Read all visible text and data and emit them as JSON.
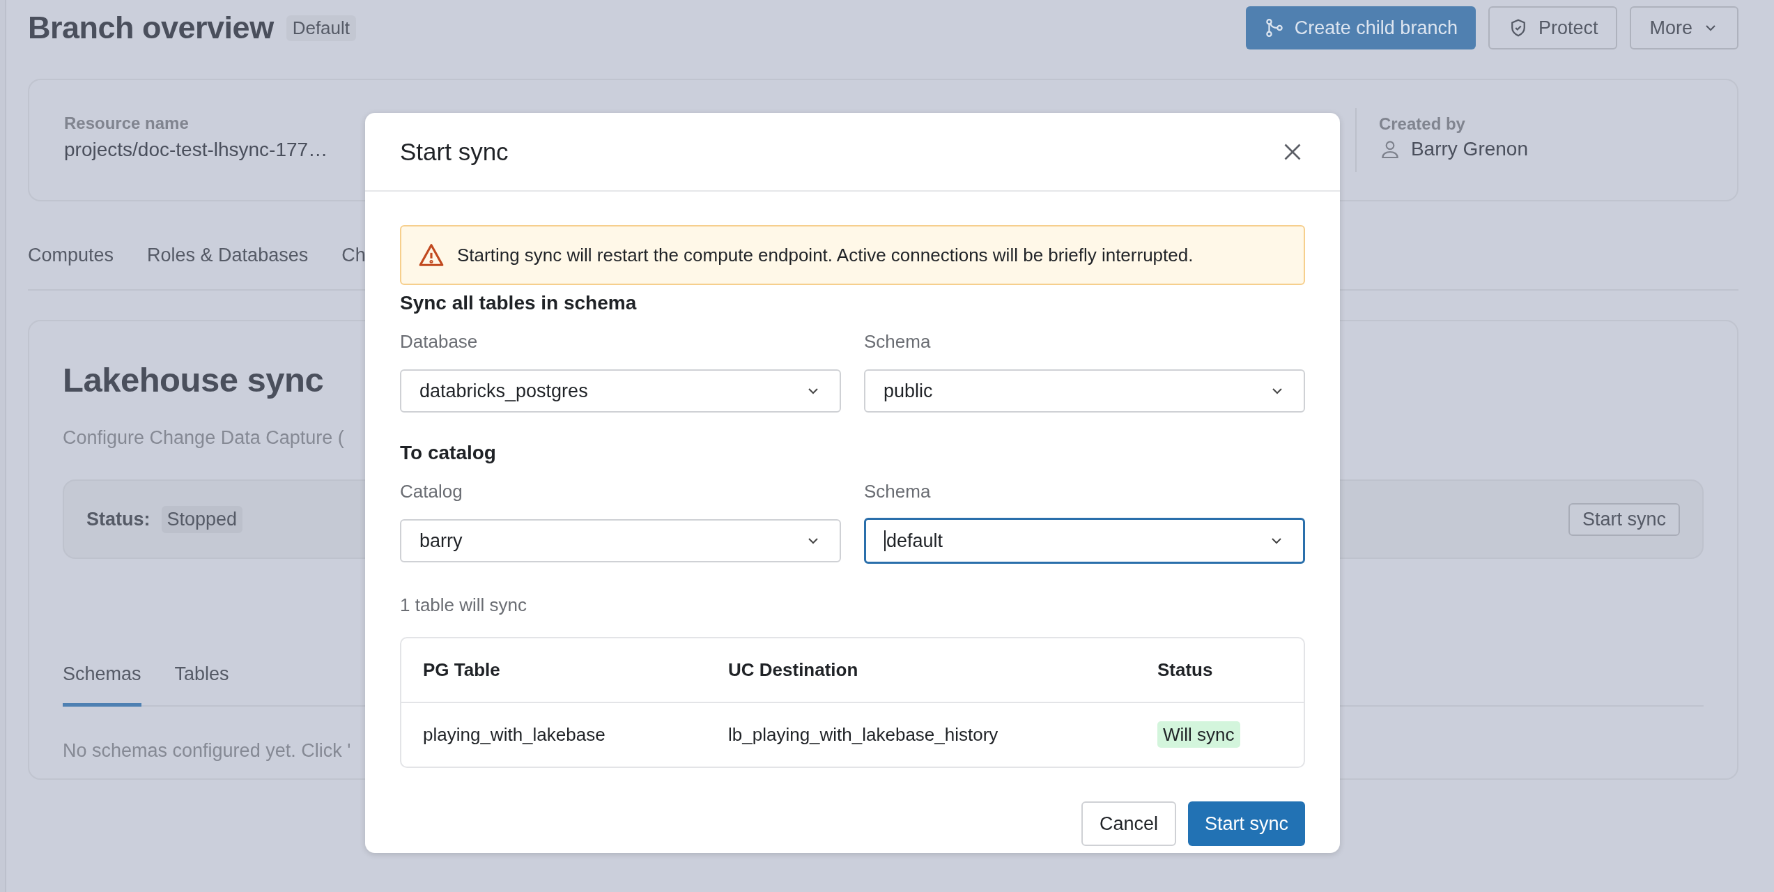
{
  "page": {
    "title": "Branch overview",
    "badge": "Default",
    "actions": [
      {
        "label": "Create child branch",
        "kind": "primary"
      },
      {
        "label": "Protect",
        "kind": "protect"
      },
      {
        "label": "More",
        "kind": "menu"
      }
    ]
  },
  "info": {
    "resource_label": "Resource name",
    "resource_value": "projects/doc-test-lhsync-177…",
    "created_label": "Created by",
    "created_value": "Barry Grenon"
  },
  "tabs": [
    {
      "label": "Computes"
    },
    {
      "label": "Roles & Databases"
    },
    {
      "label": "Ch"
    }
  ],
  "lakehouse": {
    "title": "Lakehouse sync",
    "description": "Configure Change Data Capture (",
    "status_label": "Status:",
    "status": "Stopped",
    "button": "Start sync",
    "tabs": [
      {
        "label": "Schemas",
        "selected": true
      },
      {
        "label": "Tables",
        "selected": false
      }
    ],
    "empty": "No schemas configured yet. Click '"
  },
  "modal": {
    "title": "Start sync",
    "alert": "Starting sync will restart the compute endpoint. Active connections will be briefly interrupted.",
    "source_heading": "Sync all tables in schema",
    "source_fields": [
      {
        "label": "Database",
        "value": "databricks_postgres",
        "focused": false
      },
      {
        "label": "Schema",
        "value": "public",
        "focused": false
      }
    ],
    "target_heading": "To catalog",
    "target_fields": [
      {
        "label": "Catalog",
        "value": "barry",
        "focused": false
      },
      {
        "label": "Schema",
        "value": "default",
        "focused": true
      }
    ],
    "count": "1 table will sync",
    "table": {
      "columns": [
        "PG Table",
        "UC Destination",
        "Status"
      ],
      "rows": [
        {
          "pg_table": "playing_with_lakebase",
          "uc_destination": "lb_playing_with_lakebase_history",
          "status": "Will sync"
        }
      ]
    },
    "buttons": [
      {
        "label": "Cancel",
        "kind": "secondary"
      },
      {
        "label": "Start sync",
        "kind": "primary"
      }
    ]
  }
}
